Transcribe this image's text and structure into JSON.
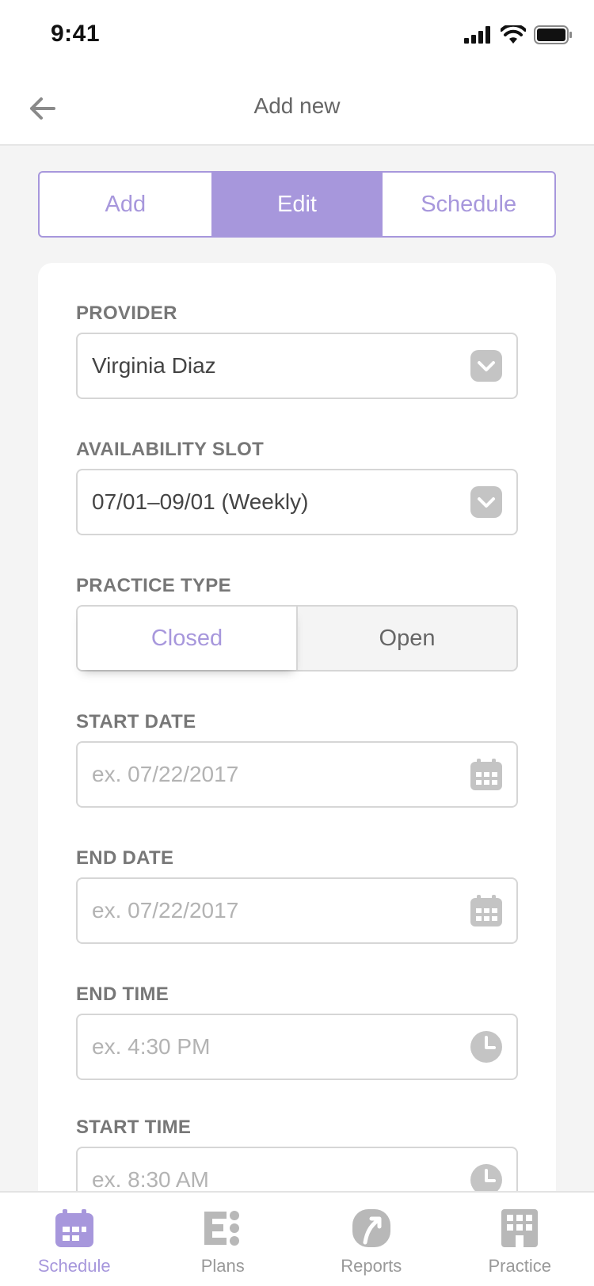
{
  "status_bar": {
    "time": "9:41"
  },
  "nav": {
    "title": "Add new",
    "back_icon": "arrow-left-icon"
  },
  "segments": [
    {
      "label": "Add",
      "active": false
    },
    {
      "label": "Edit",
      "active": true
    },
    {
      "label": "Schedule",
      "active": false
    }
  ],
  "form": {
    "provider": {
      "label": "PROVIDER",
      "value": "Virginia Diaz",
      "icon": "chevron-down-icon"
    },
    "availability_slot": {
      "label": "AVAILABILITY SLOT",
      "value": "07/01–09/01 (Weekly)",
      "icon": "chevron-down-icon"
    },
    "practice_type": {
      "label": "PRACTICE TYPE",
      "options": [
        "Closed",
        "Open"
      ],
      "selected": "Closed"
    },
    "start_date": {
      "label": "START DATE",
      "placeholder": "ex. 07/22/2017",
      "icon": "calendar-icon"
    },
    "end_date": {
      "label": "END DATE",
      "placeholder": "ex. 07/22/2017",
      "icon": "calendar-icon"
    },
    "end_time": {
      "label": "END TIME",
      "placeholder": "ex. 4:30 PM",
      "icon": "clock-icon"
    },
    "start_time": {
      "label": "START TIME",
      "placeholder": "ex. 8:30 AM",
      "icon": "clock-icon"
    }
  },
  "tab_bar": [
    {
      "label": "Schedule",
      "icon": "calendar-icon",
      "active": true
    },
    {
      "label": "Plans",
      "icon": "plans-icon",
      "active": false
    },
    {
      "label": "Reports",
      "icon": "reports-icon",
      "active": false
    },
    {
      "label": "Practice",
      "icon": "building-icon",
      "active": false
    }
  ],
  "colors": {
    "accent": "#a797dc",
    "label": "#777777",
    "icon_gray": "#c4c4c4",
    "placeholder": "#b3b3b3"
  }
}
